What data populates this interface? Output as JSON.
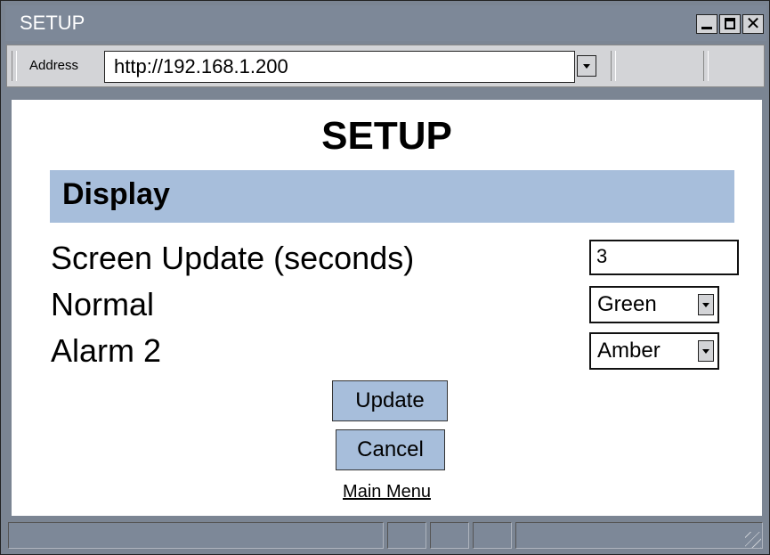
{
  "window": {
    "title": "SETUP"
  },
  "address_bar": {
    "label": "Address",
    "url": "http://192.168.1.200"
  },
  "page": {
    "title": "SETUP",
    "section": "Display",
    "fields": [
      {
        "label": "Screen Update (seconds)",
        "value": "3"
      },
      {
        "label": "Normal",
        "value": "Green"
      },
      {
        "label": "Alarm 2",
        "value": "Amber"
      }
    ],
    "update_button": "Update",
    "cancel_button": "Cancel",
    "main_menu_link": "Main Menu"
  },
  "colors": {
    "section_bar": "#a7bedb",
    "frame": "#7b8593",
    "button": "#a7bedb"
  },
  "icons": [
    "minimize-icon",
    "maximize-icon",
    "close-icon",
    "dropdown-arrow-icon",
    "resize-grip-icon"
  ]
}
